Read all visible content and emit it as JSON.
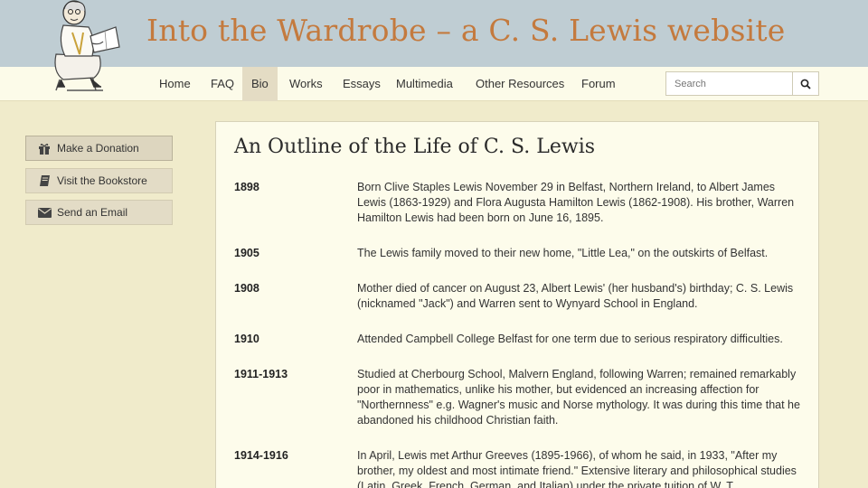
{
  "header": {
    "site_title": "Into the Wardrobe – a C. S. Lewis website"
  },
  "nav": {
    "items": [
      {
        "label": "Home"
      },
      {
        "label": "FAQ"
      },
      {
        "label": "Bio"
      },
      {
        "label": "Works"
      },
      {
        "label": "Essays"
      },
      {
        "label": "Multimedia"
      },
      {
        "label": "Other Resources"
      },
      {
        "label": "Forum"
      }
    ],
    "active": "Bio"
  },
  "search": {
    "placeholder": "Search",
    "button_icon": "search-icon"
  },
  "sidebar": {
    "buttons": [
      {
        "label": "Make a Donation",
        "icon": "gift-icon"
      },
      {
        "label": "Visit the Bookstore",
        "icon": "book-icon"
      },
      {
        "label": "Send an Email",
        "icon": "envelope-icon"
      }
    ]
  },
  "main": {
    "title": "An Outline of the Life of C. S. Lewis",
    "timeline": [
      {
        "year": "1898",
        "text": "Born Clive Staples Lewis November 29 in Belfast, Northern Ireland, to Albert James Lewis (1863-1929) and Flora Augusta Hamilton Lewis (1862-1908). His brother, Warren Hamilton Lewis had been born on June 16, 1895."
      },
      {
        "year": "1905",
        "text": "The Lewis family moved to their new home, \"Little Lea,\" on the outskirts of Belfast."
      },
      {
        "year": "1908",
        "text": "Mother died of cancer on August 23, Albert Lewis' (her husband's) birthday; C. S. Lewis (nicknamed \"Jack\") and Warren sent to Wynyard School in England."
      },
      {
        "year": "1910",
        "text": "Attended Campbell College Belfast for one term due to serious respiratory difficulties."
      },
      {
        "year": "1911-1913",
        "text": "Studied at Cherbourg School, Malvern England, following Warren; remained remarkably poor in mathematics, unlike his mother, but evidenced an increasing affection for \"Northernness\" e.g. Wagner's music and Norse mythology. It was during this time that he abandoned his childhood Christian faith."
      },
      {
        "year": "1914-1916",
        "text": "In April, Lewis met Arthur Greeves (1895-1966), of whom he said, in 1933, \"After my brother, my oldest and most intimate friend.\" Extensive literary and philosophical studies (Latin, Greek, French, German, and Italian) under the private tuition of W. T."
      }
    ]
  },
  "colors": {
    "banner": "#bfcdd3",
    "title": "#c47a3e",
    "page_bg": "#f0ebcb",
    "content_bg": "#fdfceb",
    "navbar_bg": "#fcfbe9"
  }
}
